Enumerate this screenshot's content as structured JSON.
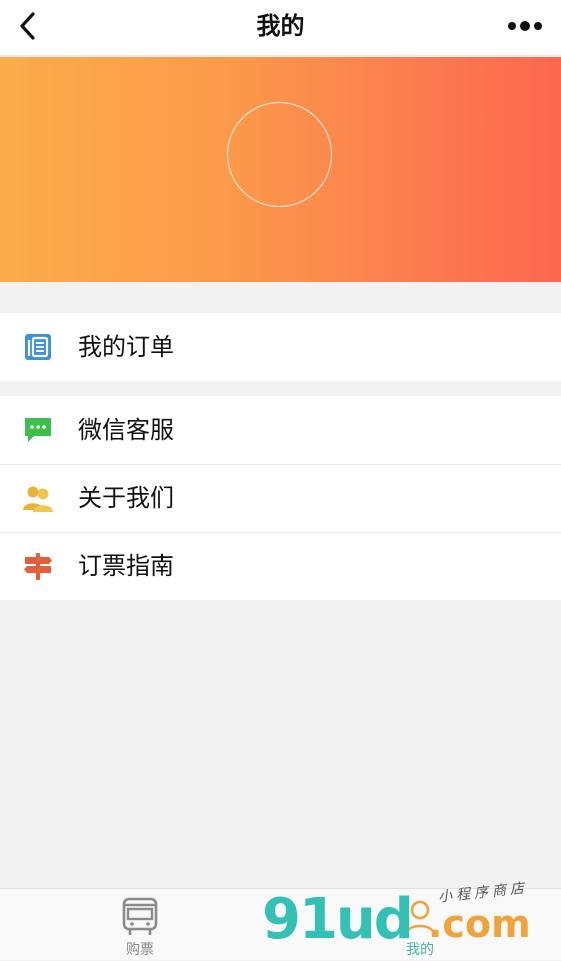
{
  "header": {
    "title": "我的",
    "back_icon": "chevron-left-icon",
    "more_icon": "more-dots-icon"
  },
  "banner": {
    "gradient_start": "#fbad4b",
    "gradient_end": "#fc674f"
  },
  "menu": {
    "group1": [
      {
        "label": "我的订单",
        "icon": "orders-icon",
        "color": "#3d8fe0"
      }
    ],
    "group2": [
      {
        "label": "微信客服",
        "icon": "chat-icon",
        "color": "#3cc04b"
      },
      {
        "label": "关于我们",
        "icon": "users-icon",
        "color": "#e8b43c"
      },
      {
        "label": "订票指南",
        "icon": "signpost-icon",
        "color": "#e5603a"
      }
    ]
  },
  "tabbar": {
    "tabs": [
      {
        "label": "购票",
        "icon": "bus-icon"
      },
      {
        "label": "我的",
        "icon": "profile-icon"
      }
    ]
  },
  "watermark": {
    "main": "91ud",
    "com": ".com",
    "tag": "小程序商店"
  }
}
